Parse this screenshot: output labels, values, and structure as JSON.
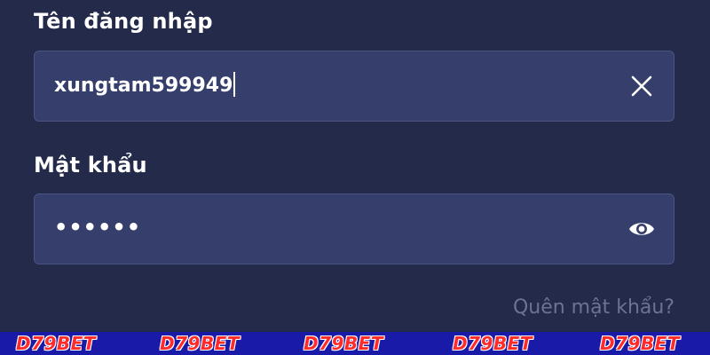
{
  "form": {
    "username": {
      "label": "Tên đăng nhập",
      "value": "xungtam599949",
      "clear_icon": "close-icon"
    },
    "password": {
      "label": "Mật khẩu",
      "masked_value": "••••••",
      "toggle_icon": "eye-icon"
    },
    "forgot_password": "Quên mật khẩu?"
  },
  "watermark": {
    "text": "D79BET",
    "repeat": 5,
    "text_color": "#ff2b2b",
    "bar_color": "#1a1aa8"
  },
  "colors": {
    "background": "#232a4a",
    "field": "#363f6c",
    "muted_link": "#6c7395"
  }
}
